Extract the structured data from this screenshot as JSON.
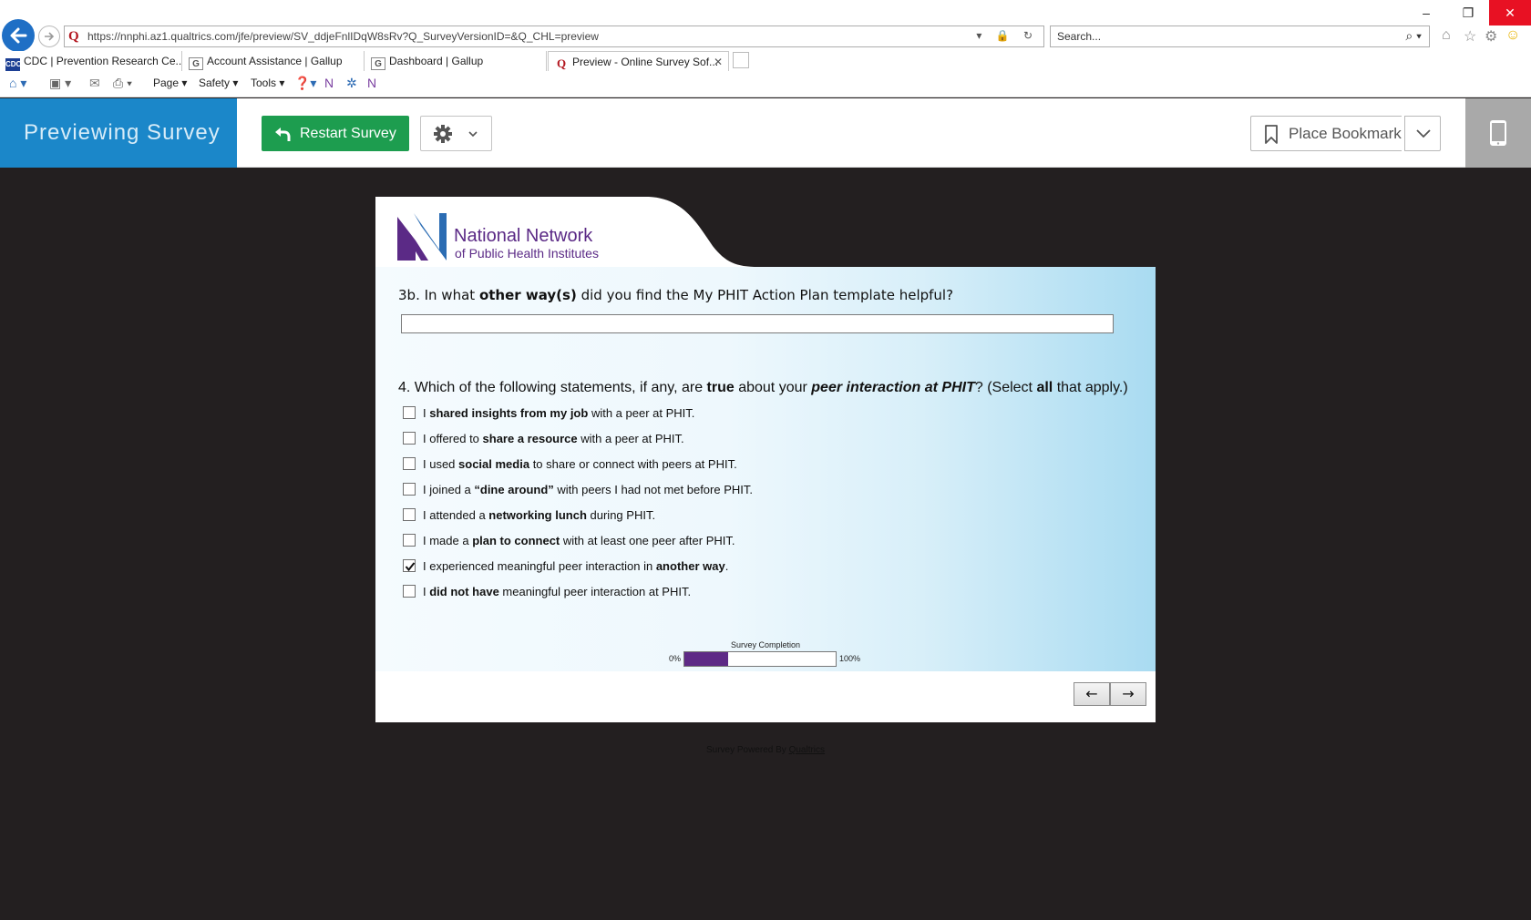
{
  "browser": {
    "url": "https://nnphi.az1.qualtrics.com/jfe/preview/SV_ddjeFnlIDqW8sRv?Q_SurveyVersionID=&Q_CHL=preview",
    "search_placeholder": "Search...",
    "tabs": [
      {
        "label": "CDC | Prevention Research Ce...",
        "icon": "cdc-favicon",
        "active": false
      },
      {
        "label": "Account Assistance | Gallup",
        "icon": "gallup-favicon",
        "active": false
      },
      {
        "label": "Dashboard | Gallup",
        "icon": "gallup-favicon",
        "active": false
      },
      {
        "label": "Preview - Online Survey Sof...",
        "icon": "qualtrics-favicon",
        "active": true
      }
    ],
    "command_bar": {
      "page": "Page",
      "safety": "Safety",
      "tools": "Tools"
    }
  },
  "preview_header": {
    "title": "Previewing Survey",
    "restart_label": "Restart Survey",
    "bookmark_label": "Place Bookmark",
    "accent": "#1b87c9",
    "restart_color": "#1d9d4f"
  },
  "logo": {
    "name": "National Network",
    "sub": "of Public Health Institutes",
    "brand_color": "#5b2a86"
  },
  "q3": {
    "number": "3b.",
    "pre": " In what ",
    "bold": "other way(s)",
    "post": " did you find the My PHIT Action Plan template helpful?",
    "value": ""
  },
  "q4": {
    "prefix": "4. Which of the following statements, if any, are ",
    "bold1": "true",
    "mid": " about your ",
    "italic_bold": "peer interaction at PHIT",
    "mid2": "? (Select ",
    "bold2": "all",
    "suffix": " that apply.)",
    "options": [
      {
        "pre": "I ",
        "bold": "shared insights from my job",
        "post": " with a peer at PHIT.",
        "checked": false
      },
      {
        "pre": "I offered to ",
        "bold": "share a resource",
        "post": " with a peer at PHIT.",
        "checked": false
      },
      {
        "pre": "I used ",
        "bold": "social media",
        "post": " to share or connect with peers at PHIT.",
        "checked": false
      },
      {
        "pre": "I joined a ",
        "bold": "“dine around”",
        "post": " with peers I had not met before PHIT.",
        "checked": false
      },
      {
        "pre": "I attended a ",
        "bold": "networking lunch",
        "post": " during PHIT.",
        "checked": false
      },
      {
        "pre": "I made a ",
        "bold": "plan to connect",
        "post": " with at least one peer after PHIT.",
        "checked": false
      },
      {
        "pre": "I experienced meaningful peer interaction in ",
        "bold": "another way",
        "post": ".",
        "checked": true
      },
      {
        "pre": "I ",
        "bold": "did not have",
        "post": " meaningful peer interaction at PHIT.",
        "checked": false
      }
    ]
  },
  "progress": {
    "title": "Survey Completion",
    "min_label": "0%",
    "max_label": "100%",
    "fraction": 0.29,
    "fill_color": "#5e2a86"
  },
  "nav": {
    "back_label": "←",
    "next_label": "→"
  },
  "footer": {
    "text": "Survey Powered By ",
    "link": "Qualtrics"
  }
}
